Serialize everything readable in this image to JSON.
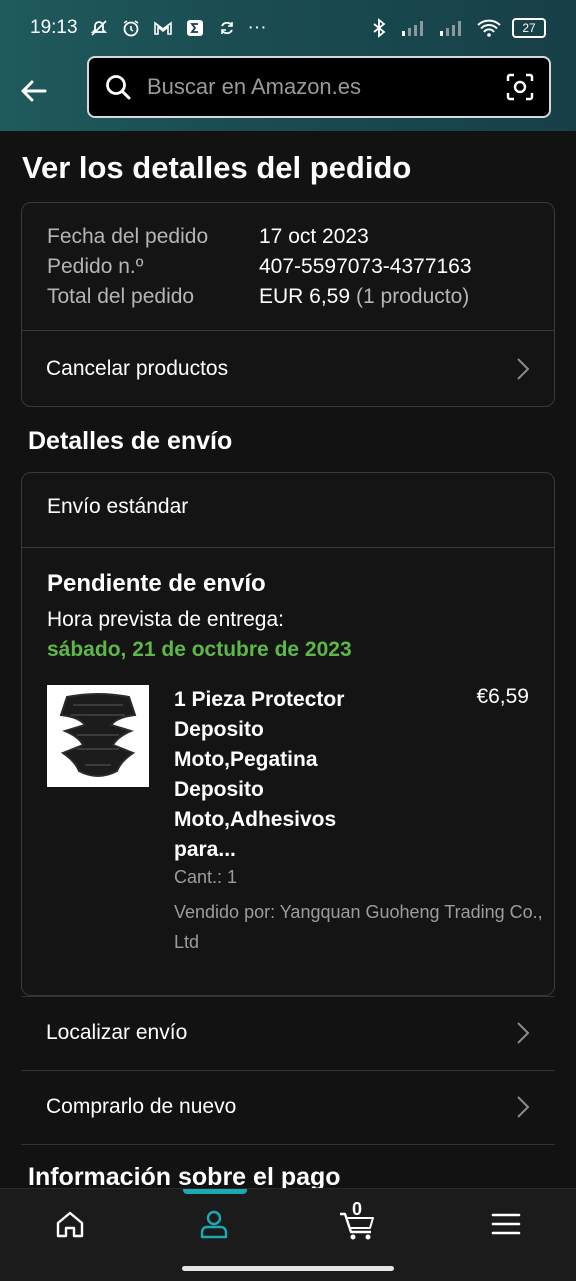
{
  "status_bar": {
    "time": "19:13",
    "battery": "27",
    "more": "···"
  },
  "search": {
    "placeholder": "Buscar en Amazon.es"
  },
  "page": {
    "title": "Ver los detalles del pedido"
  },
  "order_summary": {
    "date_label": "Fecha del pedido",
    "date_value": "17 oct 2023",
    "number_label": "Pedido n.º",
    "number_value": "407-5597073-4377163",
    "total_label": "Total del pedido",
    "total_value": "EUR 6,59",
    "total_extra": "(1 producto)",
    "cancel_label": "Cancelar productos"
  },
  "shipping": {
    "section_title": "Detalles de envío",
    "method": "Envío estándar",
    "status": "Pendiente de envío",
    "eta_label": "Hora prevista de entrega:",
    "eta_date": "sábado, 21 de octubre de 2023",
    "eta_color": "#5db848",
    "item": {
      "title": "1 Pieza Protector Deposito Moto,Pegatina Deposito Moto,Adhesivos para...",
      "price": "€6,59",
      "qty": "Cant.: 1",
      "seller": "Vendido por: Yangquan Guoheng Trading Co., Ltd"
    }
  },
  "actions": {
    "track": "Localizar envío",
    "buy_again": "Comprarlo de nuevo"
  },
  "payment": {
    "section_title": "Información sobre el pago"
  },
  "bottom_nav": {
    "active": "account",
    "accent_color": "#1ea7b4",
    "cart_count": "0",
    "items": [
      "home-icon",
      "account-icon",
      "cart-icon",
      "menu-icon"
    ]
  }
}
